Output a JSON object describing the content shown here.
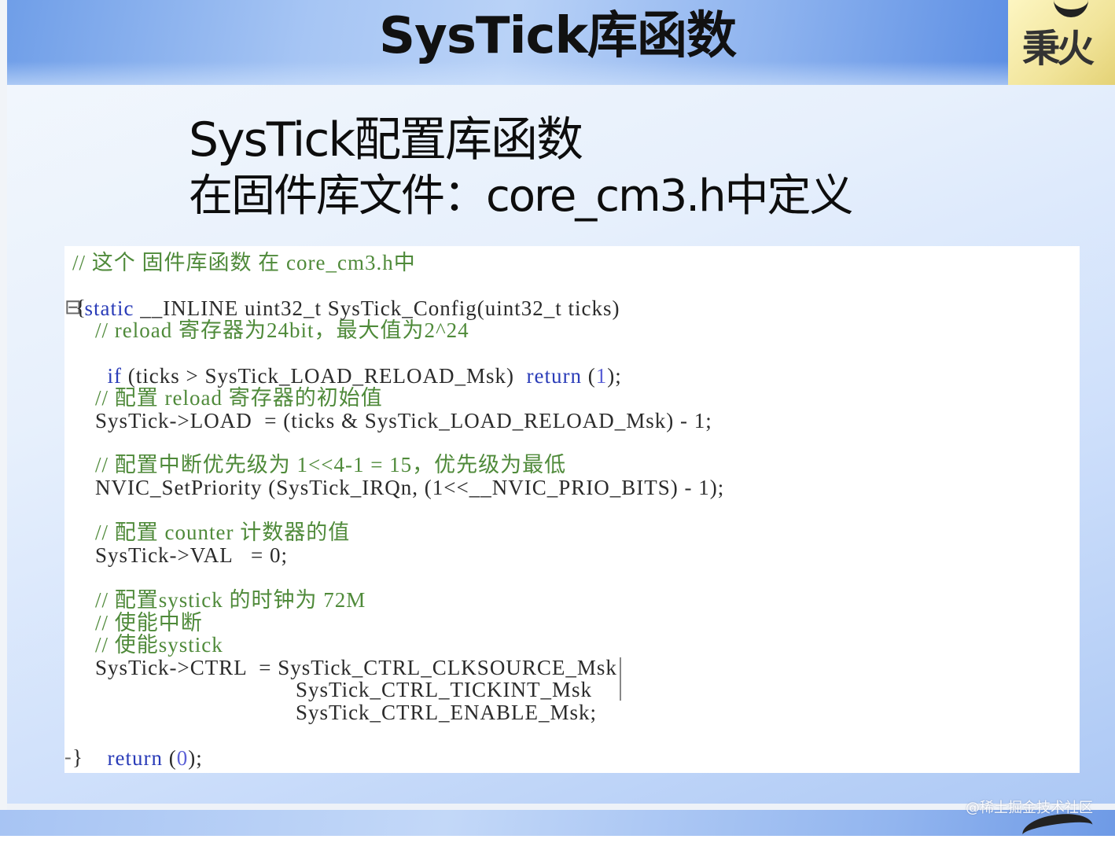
{
  "header": {
    "title": "SysTick库函数",
    "logo_text": "秉火"
  },
  "subtitle": {
    "line1": "SysTick配置库函数",
    "line2": "在固件库文件：core_cm3.h中定义"
  },
  "code": {
    "lines": [
      {
        "text": "// 这个 固件库函数 在 core_cm3.h中",
        "kind": "comment"
      },
      {
        "text": "static __INLINE uint32_t SysTick_Config(uint32_t ticks)",
        "kind": "signature"
      },
      {
        "text": "{",
        "kind": "plain"
      },
      {
        "text": "// reload 寄存器为24bit，最大值为2^24",
        "kind": "comment"
      },
      {
        "text": "if (ticks > SysTick_LOAD_RELOAD_Msk)  return (1);",
        "kind": "if"
      },
      {
        "text": "// 配置 reload 寄存器的初始值",
        "kind": "comment"
      },
      {
        "text": "SysTick->LOAD  = (ticks & SysTick_LOAD_RELOAD_Msk) - 1;",
        "kind": "plain"
      },
      {
        "text": "// 配置中断优先级为 1<<4-1 = 15，优先级为最低",
        "kind": "comment"
      },
      {
        "text": "NVIC_SetPriority (SysTick_IRQn, (1<<__NVIC_PRIO_BITS) - 1);",
        "kind": "plain"
      },
      {
        "text": "// 配置 counter 计数器的值",
        "kind": "comment"
      },
      {
        "text": "SysTick->VAL   = 0;",
        "kind": "plain"
      },
      {
        "text": "// 配置systick 的时钟为 72M",
        "kind": "comment"
      },
      {
        "text": "// 使能中断",
        "kind": "comment"
      },
      {
        "text": "// 使能systick",
        "kind": "comment"
      },
      {
        "text": "SysTick->CTRL  = SysTick_CTRL_CLKSOURCE_Msk",
        "kind": "plain"
      },
      {
        "text": "SysTick_CTRL_TICKINT_Msk",
        "kind": "plain"
      },
      {
        "text": "SysTick_CTRL_ENABLE_Msk;",
        "kind": "plain"
      },
      {
        "text": "return (0);",
        "kind": "return"
      },
      {
        "text": "}",
        "kind": "plain"
      }
    ],
    "bracket_open_marker": "⊟",
    "bracket_close_marker": "-"
  },
  "watermark": "@稀土掘金技术社区",
  "colors": {
    "comment": "#4f8a3a",
    "keyword": "#2a3cb8",
    "number": "#5a5fd6",
    "text": "#2b2b2b"
  }
}
